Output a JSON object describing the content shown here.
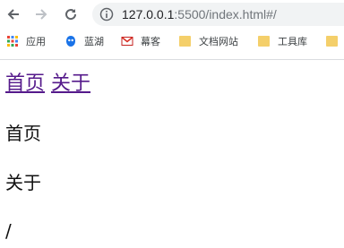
{
  "browser": {
    "url_host": "127.0.0.1",
    "url_rest": ":5500/index.html#/",
    "bookmarks": [
      {
        "label": "应用",
        "icon": "apps-grid-icon"
      },
      {
        "label": "蓝湖",
        "icon": "lanhu-icon"
      },
      {
        "label": "幕客",
        "icon": "gmail-icon"
      },
      {
        "label": "文档网站",
        "icon": "folder-icon"
      },
      {
        "label": "工具库",
        "icon": "folder-icon"
      }
    ]
  },
  "page": {
    "links": [
      {
        "label": "首页"
      },
      {
        "label": "关于"
      }
    ],
    "views": [
      "首页",
      "关于"
    ],
    "current_path": "/"
  },
  "colors": {
    "visited_link": "#551a8b",
    "omnibox_bg": "#f1f3f4",
    "folder": "#f4cf6a"
  }
}
